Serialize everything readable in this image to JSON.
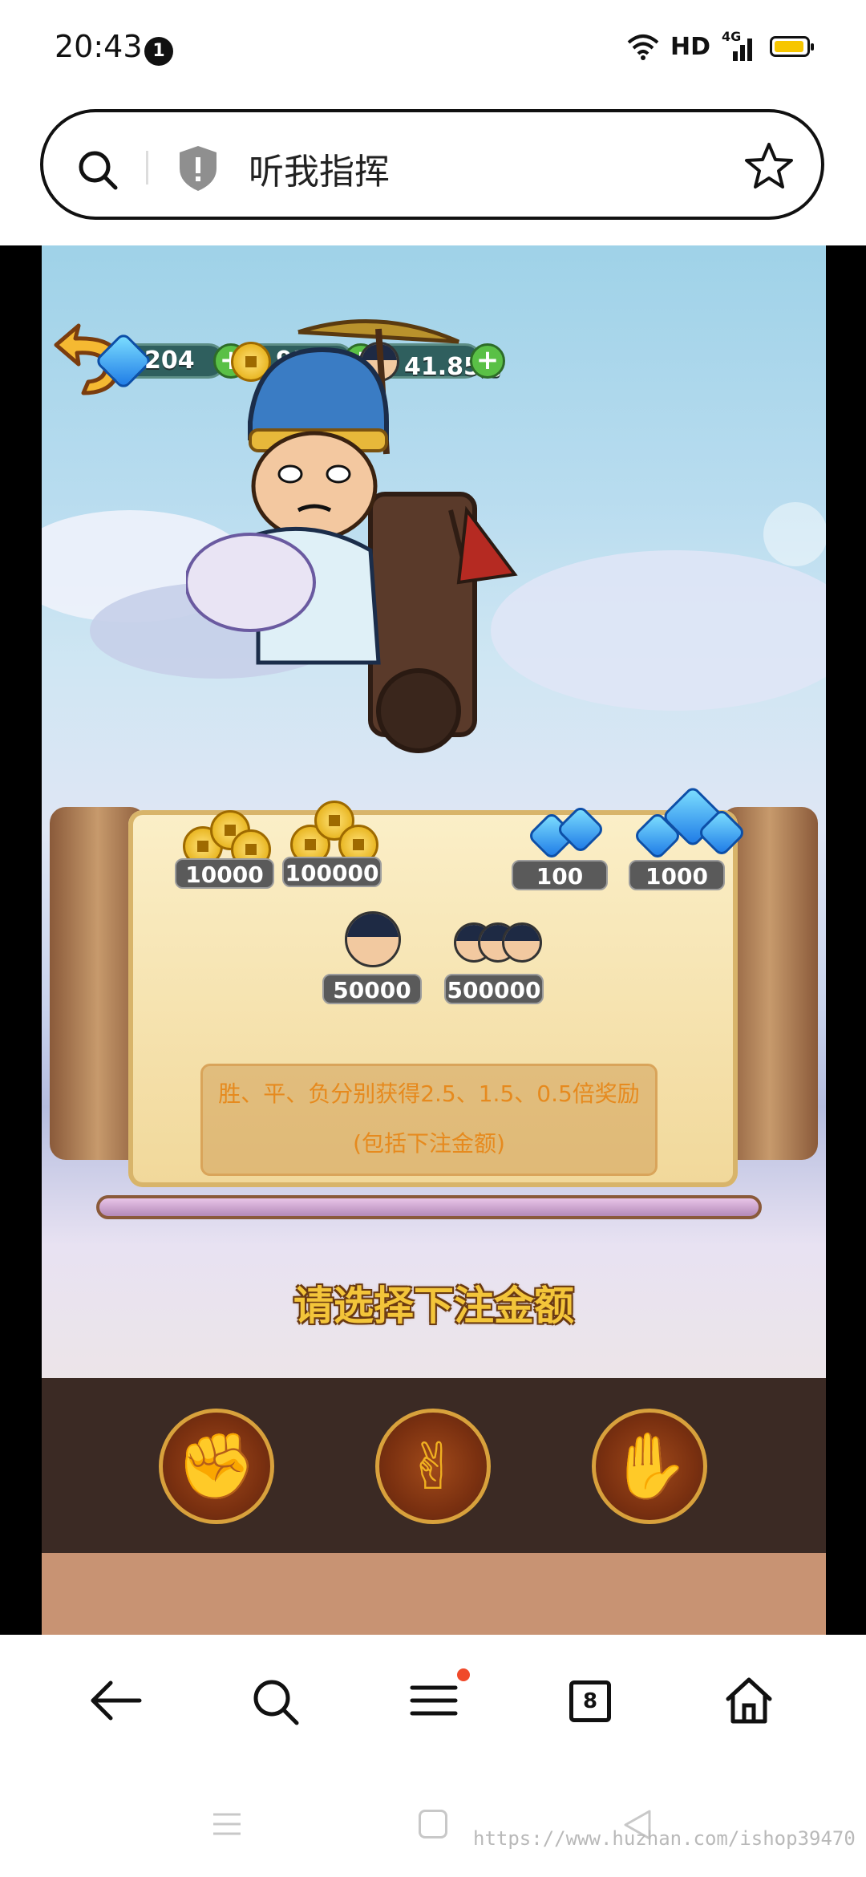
{
  "status_bar": {
    "time": "20:43",
    "notification_count": "1",
    "network": "HD",
    "signal": "4G"
  },
  "search_bar": {
    "title": "听我指挥"
  },
  "game": {
    "resources": [
      {
        "name": "gems",
        "value": "204",
        "icon": "gem-icon"
      },
      {
        "name": "copper",
        "value": "9390",
        "icon": "coin-icon"
      },
      {
        "name": "soldiers",
        "value": "41.85万",
        "icon": "soldier-icon"
      }
    ],
    "bets": {
      "coins": [
        "10000",
        "100000"
      ],
      "gems": [
        "100",
        "1000"
      ],
      "soldiers": [
        "50000",
        "500000"
      ]
    },
    "info_line1": "胜、平、负分别获得2.5、1.5、0.5倍奖励",
    "info_line2": "(包括下注金额)",
    "prompt": "请选择下注金额",
    "hands": [
      "rock",
      "scissors",
      "paper"
    ]
  },
  "bottom_nav": {
    "tab_count": "8"
  },
  "watermark": "https://www.huzhan.com/ishop39470",
  "colors": {
    "prompt": "#f3c53a",
    "info_text": "#e68a1e",
    "plus": "#5ac046",
    "hand_border": "#d8a13c"
  }
}
